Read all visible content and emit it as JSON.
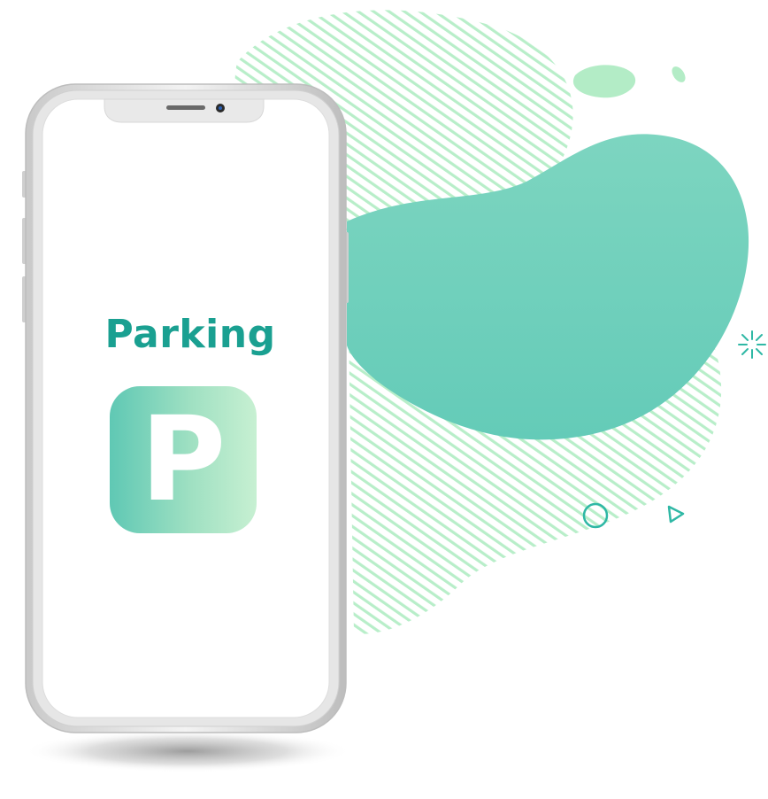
{
  "screen": {
    "title": "Parking",
    "icon_letter": "P",
    "icon_name": "parking-icon"
  },
  "colors": {
    "title": "#1aa091",
    "blob": "#6fd3bd",
    "stripes": "#b5ecc8",
    "accent_shapes": "#2fb8a5",
    "icon_gradient_start": "#5fc8b4",
    "icon_gradient_end": "#c7f0d2"
  }
}
